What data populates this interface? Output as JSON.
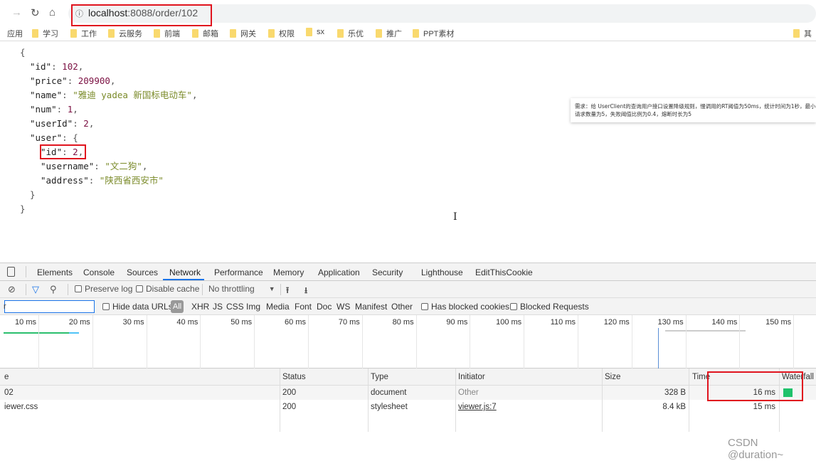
{
  "browser": {
    "url_host": "localhost",
    "url_path": ":8088/order/102",
    "icons": [
      "forward-icon",
      "reload-icon",
      "home-icon",
      "info-icon"
    ]
  },
  "bookmarks": [
    "应用",
    "学习",
    "工作",
    "云服务",
    "前端",
    "邮箱",
    "网关",
    "权限",
    "sx",
    "乐优",
    "推广",
    "PPT素材",
    "其"
  ],
  "json_view": {
    "lines": [
      [
        [
          "p",
          "{"
        ]
      ],
      [
        [
          "k",
          "\"id\""
        ],
        [
          "p",
          ": "
        ],
        [
          "n",
          "102"
        ],
        [
          "p",
          ","
        ]
      ],
      [
        [
          "k",
          "\"price\""
        ],
        [
          "p",
          ": "
        ],
        [
          "n",
          "209900"
        ],
        [
          "p",
          ","
        ]
      ],
      [
        [
          "k",
          "\"name\""
        ],
        [
          "p",
          ": "
        ],
        [
          "s",
          "\"雅迪 yadea 新国标电动车\""
        ],
        [
          "p",
          ","
        ]
      ],
      [
        [
          "k",
          "\"num\""
        ],
        [
          "p",
          ": "
        ],
        [
          "n",
          "1"
        ],
        [
          "p",
          ","
        ]
      ],
      [
        [
          "k",
          "\"userId\""
        ],
        [
          "p",
          ": "
        ],
        [
          "n",
          "2"
        ],
        [
          "p",
          ","
        ]
      ],
      [
        [
          "k",
          "\"user\""
        ],
        [
          "p",
          ": {"
        ]
      ],
      [
        [
          "k",
          "\"id\""
        ],
        [
          "p",
          ": "
        ],
        [
          "n",
          "2"
        ],
        [
          "p",
          ","
        ]
      ],
      [
        [
          "k",
          "\"username\""
        ],
        [
          "p",
          ": "
        ],
        [
          "s",
          "\"文二狗\""
        ],
        [
          "p",
          ","
        ]
      ],
      [
        [
          "k",
          "\"address\""
        ],
        [
          "p",
          ": "
        ],
        [
          "s",
          "\"陕西省西安市\""
        ]
      ],
      [
        [
          "p",
          "}"
        ]
      ],
      [
        [
          "p",
          "}"
        ]
      ]
    ]
  },
  "note": {
    "line1": "需求：给 UserClient的查询用户接口设置降级规则，慢调用的RT阈值为50ms，统计时间为1秒，最小",
    "line2": "请求数量为5，失败阈值比例为0.4，熔断时长为5"
  },
  "devtools": {
    "tabs": [
      "Elements",
      "Console",
      "Sources",
      "Network",
      "Performance",
      "Memory",
      "Application",
      "Security",
      "Lighthouse",
      "EditThisCookie"
    ],
    "active_tab": "Network",
    "toolbar": {
      "preserve_log": "Preserve log",
      "disable_cache": "Disable cache",
      "throttling": "No throttling"
    },
    "filter": {
      "value": "r",
      "hide_data_urls": "Hide data URLs",
      "types": [
        "All",
        "XHR",
        "JS",
        "CSS",
        "Img",
        "Media",
        "Font",
        "Doc",
        "WS",
        "Manifest",
        "Other"
      ],
      "has_blocked_cookies": "Has blocked cookies",
      "blocked_requests": "Blocked Requests"
    },
    "timeline_ticks": [
      "10 ms",
      "20 ms",
      "30 ms",
      "40 ms",
      "50 ms",
      "60 ms",
      "70 ms",
      "80 ms",
      "90 ms",
      "100 ms",
      "110 ms",
      "120 ms",
      "130 ms",
      "140 ms",
      "150 ms"
    ],
    "columns": [
      "e",
      "Status",
      "Type",
      "Initiator",
      "Size",
      "Time",
      "Waterfall"
    ],
    "rows": [
      {
        "name": "02",
        "status": "200",
        "type": "document",
        "initiator": "Other",
        "size": "328 B",
        "time": "16 ms"
      },
      {
        "name": "iewer.css",
        "status": "200",
        "type": "stylesheet",
        "initiator": "viewer.js:7",
        "size": "8.4 kB",
        "time": "15 ms"
      }
    ],
    "waterfall_color": "#1fc26b"
  },
  "watermark": "CSDN @duration~"
}
